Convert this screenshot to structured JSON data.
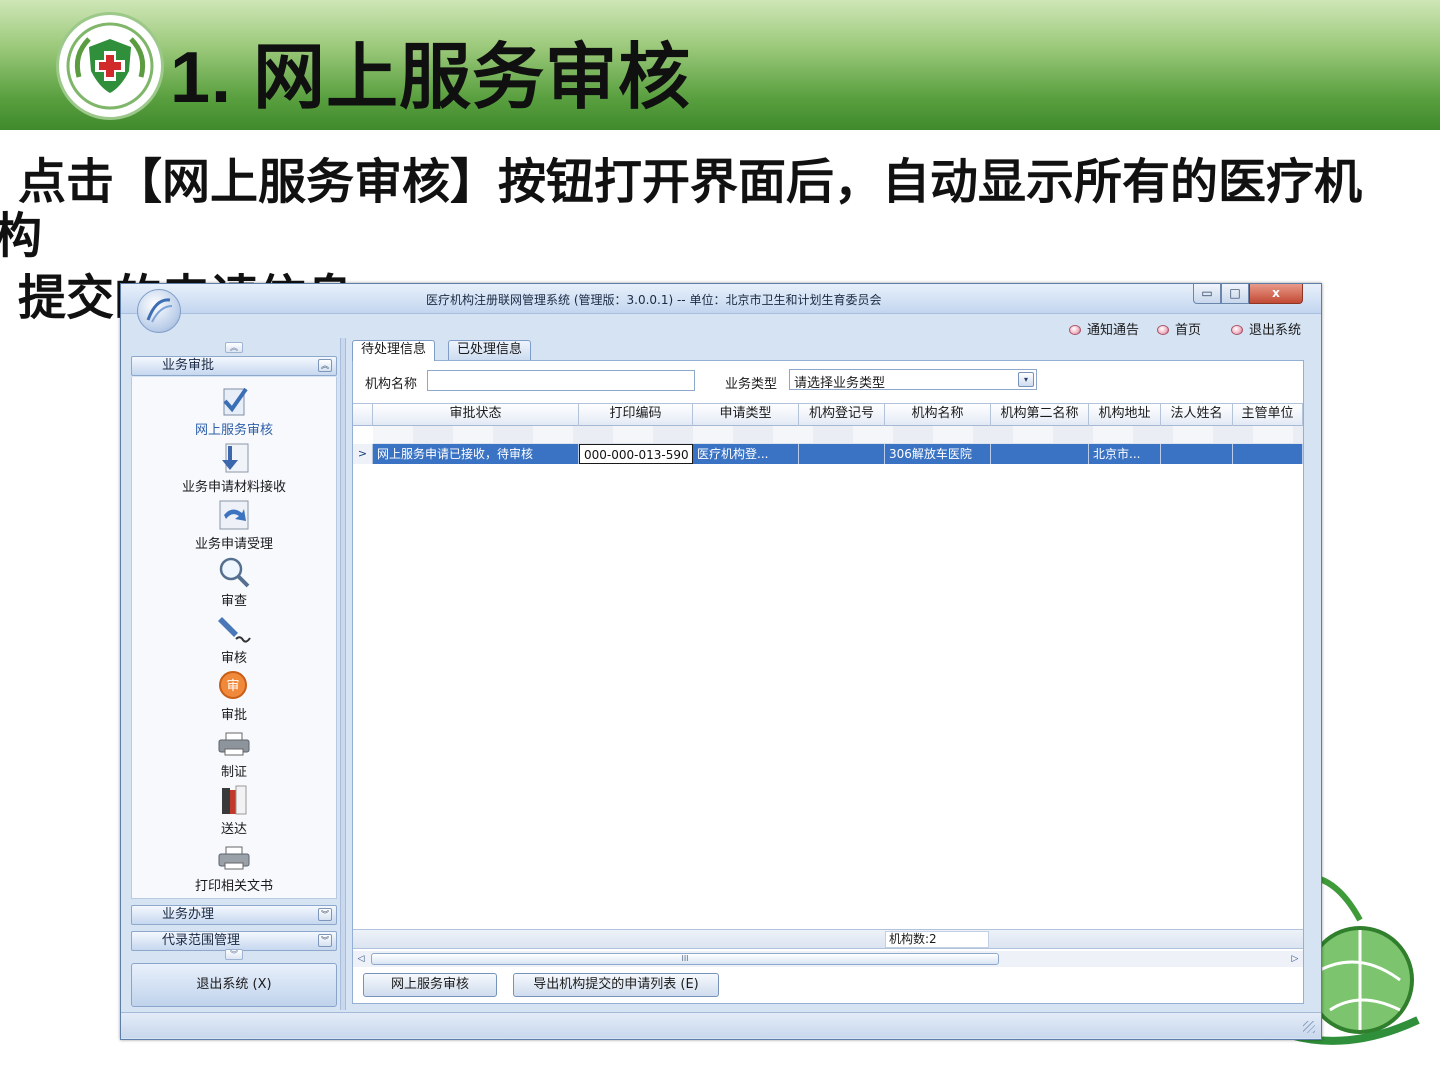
{
  "slide": {
    "title": "1. 网上服务审核",
    "desc_line1": "点击【网上服务审核】按钮打开界面后，自动显示所有的医疗机",
    "desc_line2": "构",
    "desc_line3": "提交的申请信息"
  },
  "window": {
    "title": "医疗机构注册联网管理系统 (管理版：3.0.0.1) -- 单位：北京市卫生和计划生育委员会",
    "min_label": "▭",
    "max_label": "□",
    "close_label": "x"
  },
  "topnav": {
    "notice": "通知通告",
    "home": "首页",
    "exit": "退出系统"
  },
  "sidebar": {
    "scroll_up": "︽",
    "scroll_down": "︾",
    "group_approval": "业务审批",
    "group_approval_chevron": "︽",
    "items": [
      {
        "label": "网上服务审核",
        "icon": "check-document-icon"
      },
      {
        "label": "业务申请材料接收",
        "icon": "download-arrow-icon"
      },
      {
        "label": "业务申请受理",
        "icon": "forward-arrow-icon"
      },
      {
        "label": "审查",
        "icon": "magnifier-icon"
      },
      {
        "label": "审核",
        "icon": "pen-sign-icon"
      },
      {
        "label": "审批",
        "icon": "approve-seal-icon"
      },
      {
        "label": "制证",
        "icon": "printer-icon"
      },
      {
        "label": "送达",
        "icon": "book-delivery-icon"
      },
      {
        "label": "打印相关文书",
        "icon": "print-document-icon"
      }
    ],
    "group_business": "业务办理",
    "group_business_chevron": "︾",
    "group_agent": "代录范围管理",
    "group_agent_chevron": "︾",
    "exit_button": "退出系统 (X)"
  },
  "tabs": {
    "pending": "待处理信息",
    "done": "已处理信息"
  },
  "filters": {
    "org_name_label": "机构名称",
    "org_name_value": "",
    "biz_type_label": "业务类型",
    "biz_type_value": "请选择业务类型",
    "biz_type_arrow": "▾"
  },
  "grid": {
    "columns": [
      "审批状态",
      "打印编码",
      "申请类型",
      "机构登记号",
      "机构名称",
      "机构第二名称",
      "机构地址",
      "法人姓名",
      "主管单位"
    ],
    "selected_row": {
      "indicator": ">",
      "cells": [
        "网上服务申请已接收，待审核",
        "000-000-013-590",
        "医疗机构登...",
        "",
        "306解放车医院",
        "",
        "北京市...",
        "",
        ""
      ]
    },
    "org_count": "机构数:2",
    "scroll_left": "◁",
    "scroll_right": "▷",
    "scroll_thumb": "III"
  },
  "buttons": {
    "online_audit": "网上服务审核",
    "export": "导出机构提交的申请列表 (E)"
  },
  "colors": {
    "slide_header_green": "#5aa040",
    "selection_blue": "#3a73c4",
    "window_chrome": "#d6e3f3"
  }
}
